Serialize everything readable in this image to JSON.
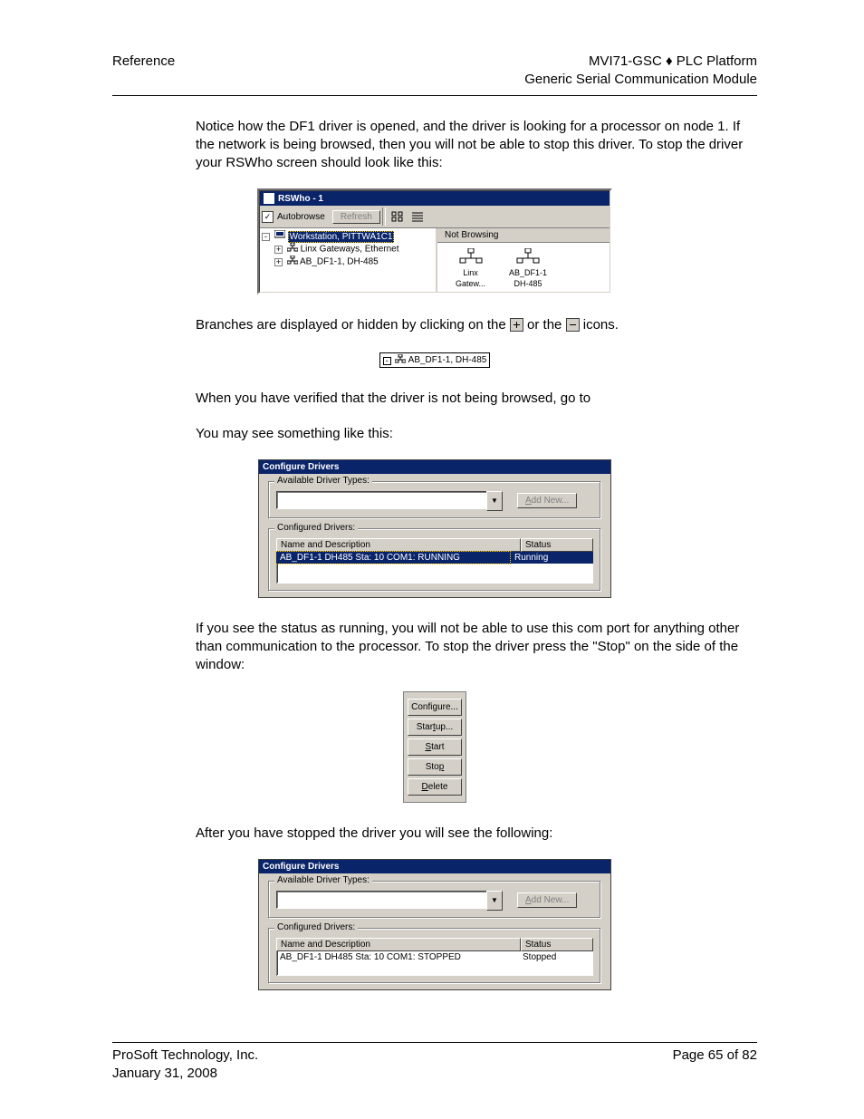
{
  "header": {
    "left": "Reference",
    "right1": "MVI71-GSC ♦ PLC Platform",
    "right2": "Generic Serial Communication Module"
  },
  "para1": "Notice how the DF1 driver is opened, and the driver is looking for a processor on node 1. If the network is being browsed, then you will not be able to stop this driver. To stop the driver your RSWho screen should look like this:",
  "rswho": {
    "title": "RSWho - 1",
    "autobrowse_label": "Autobrowse",
    "autobrowse_checked": "✓",
    "refresh_label": "Refresh",
    "notbrowsing_label": "Not Browsing",
    "tree": {
      "root": "Workstation, PITTWA1C1",
      "child1": "Linx Gateways, Ethernet",
      "child2": "AB_DF1-1, DH-485"
    },
    "icons": {
      "left_label1": "Linx",
      "left_label2": "Gatew...",
      "right_label1": "AB_DF1-1",
      "right_label2": "DH-485"
    }
  },
  "para2a": "Branches are displayed or hidden by clicking on the ",
  "para2b": " or the ",
  "para2c": " icons.",
  "treenode_label": "AB_DF1-1, DH-485",
  "para3": "When you have verified that the driver is not being browsed, go to",
  "para4": "You may see something like this:",
  "cfg": {
    "title": "Configure Drivers",
    "available_label": "Available Driver Types:",
    "addnew_label_pre": "",
    "addnew_label": "Add New...",
    "configured_label": "Configured Drivers:",
    "col_name": "Name and Description",
    "col_status": "Status",
    "row1_name": "AB_DF1-1 DH485 Sta: 10 COM1: RUNNING",
    "row1_status": "Running"
  },
  "para5": "If you see the status as running, you will not be able to use this com port for anything other than communication to the processor. To stop the driver press the \"Stop\" on the side of the window:",
  "btns": {
    "configure": "Configure...",
    "startup": "Startup...",
    "start": "Start",
    "stop": "Stop",
    "delete": "Delete"
  },
  "para6": "After you have stopped the driver you will see the following:",
  "cfg2": {
    "row1_name": "AB_DF1-1 DH485 Sta: 10 COM1: STOPPED",
    "row1_status": "Stopped"
  },
  "footer": {
    "left1": "ProSoft Technology, Inc.",
    "left2": "January 31, 2008",
    "right": "Page 65 of 82"
  }
}
